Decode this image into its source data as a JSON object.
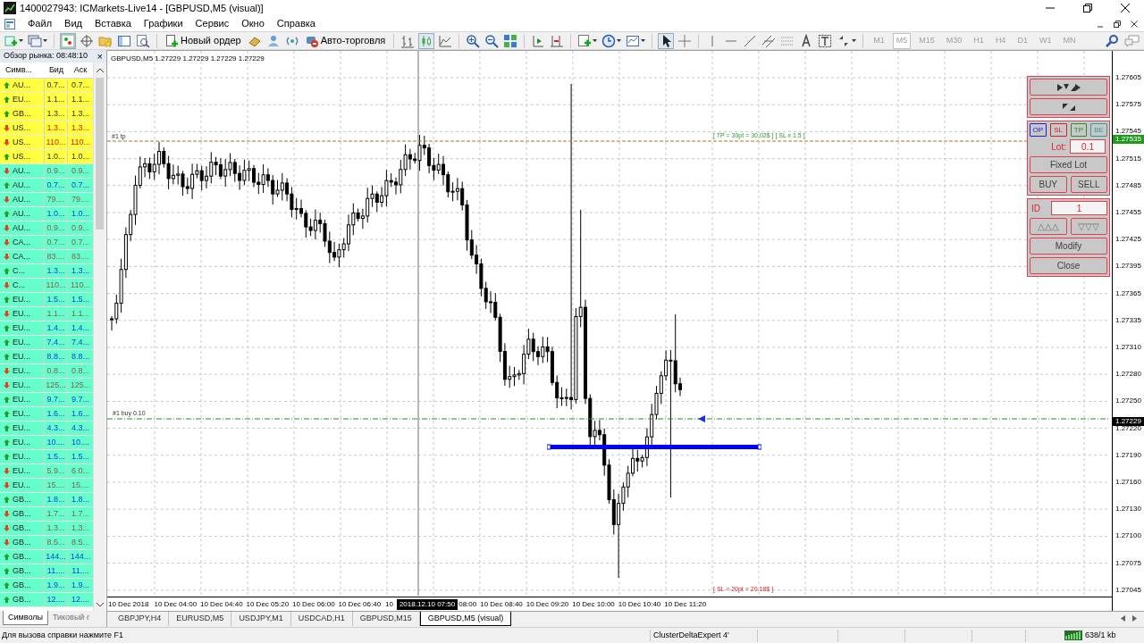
{
  "window": {
    "title": "1400027943: ICMarkets-Live14 - [GBPUSD,M5 (visual)]"
  },
  "menu": [
    "Файл",
    "Вид",
    "Вставка",
    "Графики",
    "Сервис",
    "Окно",
    "Справка"
  ],
  "toolbar": {
    "new_order": "Новый ордер",
    "auto_trading": "Авто-торговля",
    "timeframes": [
      {
        "label": "M1",
        "selected": false
      },
      {
        "label": "M5",
        "selected": true
      },
      {
        "label": "M15",
        "selected": false
      },
      {
        "label": "M30",
        "selected": false
      },
      {
        "label": "H1",
        "selected": false
      },
      {
        "label": "H4",
        "selected": false
      },
      {
        "label": "D1",
        "selected": false
      },
      {
        "label": "W1",
        "selected": false
      },
      {
        "label": "MN",
        "selected": false
      }
    ]
  },
  "market_watch": {
    "title": "Обзор рынка: 08:48:10",
    "close": "×",
    "columns": [
      "Симв...",
      "Бид",
      "Аск"
    ],
    "rows": [
      {
        "symbol": "AU...",
        "bid": "0.7...",
        "ask": "0.7...",
        "rising": true,
        "kind": "highlighted"
      },
      {
        "symbol": "EU...",
        "bid": "1.1...",
        "ask": "1.1...",
        "rising": true,
        "kind": "highlighted"
      },
      {
        "symbol": "GB...",
        "bid": "1.3...",
        "ask": "1.3...",
        "rising": true,
        "kind": "highlighted"
      },
      {
        "symbol": "US...",
        "bid": "1.3...",
        "ask": "1.3...",
        "rising": false,
        "kind": "highlighted"
      },
      {
        "symbol": "US...",
        "bid": "110...",
        "ask": "110...",
        "rising": false,
        "kind": "highlighted"
      },
      {
        "symbol": "US...",
        "bid": "1.0...",
        "ask": "1.0...",
        "rising": true,
        "kind": "highlighted"
      },
      {
        "symbol": "AU...",
        "bid": "0.9...",
        "ask": "0.9...",
        "rising": false,
        "kind": "normal"
      },
      {
        "symbol": "AU...",
        "bid": "0.7...",
        "ask": "0.7...",
        "rising": true,
        "kind": "normal"
      },
      {
        "symbol": "AU...",
        "bid": "79....",
        "ask": "79....",
        "rising": false,
        "kind": "normal"
      },
      {
        "symbol": "AU...",
        "bid": "1.0...",
        "ask": "1.0...",
        "rising": true,
        "kind": "normal"
      },
      {
        "symbol": "AU...",
        "bid": "0.9...",
        "ask": "0.9...",
        "rising": false,
        "kind": "normal"
      },
      {
        "symbol": "CA...",
        "bid": "0.7...",
        "ask": "0.7...",
        "rising": false,
        "kind": "normal"
      },
      {
        "symbol": "CA...",
        "bid": "83....",
        "ask": "83....",
        "rising": false,
        "kind": "normal"
      },
      {
        "symbol": "C...",
        "bid": "1.3...",
        "ask": "1.3...",
        "rising": true,
        "kind": "normal"
      },
      {
        "symbol": "C...",
        "bid": "110...",
        "ask": "110...",
        "rising": false,
        "kind": "normal"
      },
      {
        "symbol": "EU...",
        "bid": "1.5...",
        "ask": "1.5...",
        "rising": true,
        "kind": "normal"
      },
      {
        "symbol": "EU...",
        "bid": "1.1...",
        "ask": "1.1...",
        "rising": false,
        "kind": "normal"
      },
      {
        "symbol": "EU...",
        "bid": "1.4...",
        "ask": "1.4...",
        "rising": true,
        "kind": "normal"
      },
      {
        "symbol": "EU...",
        "bid": "7.4...",
        "ask": "7.4...",
        "rising": true,
        "kind": "normal"
      },
      {
        "symbol": "EU...",
        "bid": "8.8...",
        "ask": "8.8...",
        "rising": true,
        "kind": "normal"
      },
      {
        "symbol": "EU...",
        "bid": "0.8...",
        "ask": "0.8...",
        "rising": false,
        "kind": "normal"
      },
      {
        "symbol": "EU...",
        "bid": "125...",
        "ask": "125...",
        "rising": false,
        "kind": "normal"
      },
      {
        "symbol": "EU...",
        "bid": "9.7...",
        "ask": "9.7...",
        "rising": true,
        "kind": "normal"
      },
      {
        "symbol": "EU...",
        "bid": "1.6...",
        "ask": "1.6...",
        "rising": true,
        "kind": "normal"
      },
      {
        "symbol": "EU...",
        "bid": "4.3...",
        "ask": "4.3...",
        "rising": true,
        "kind": "normal"
      },
      {
        "symbol": "EU...",
        "bid": "10....",
        "ask": "10....",
        "rising": true,
        "kind": "normal"
      },
      {
        "symbol": "EU...",
        "bid": "1.5...",
        "ask": "1.5...",
        "rising": true,
        "kind": "normal"
      },
      {
        "symbol": "EU...",
        "bid": "5.9...",
        "ask": "6.0...",
        "rising": false,
        "kind": "normal"
      },
      {
        "symbol": "EU...",
        "bid": "15....",
        "ask": "15....",
        "rising": false,
        "kind": "normal"
      },
      {
        "symbol": "GB...",
        "bid": "1.8...",
        "ask": "1.8...",
        "rising": true,
        "kind": "normal"
      },
      {
        "symbol": "GB...",
        "bid": "1.7...",
        "ask": "1.7...",
        "rising": false,
        "kind": "normal"
      },
      {
        "symbol": "GB...",
        "bid": "1.3...",
        "ask": "1.3...",
        "rising": false,
        "kind": "normal"
      },
      {
        "symbol": "GB...",
        "bid": "8.5...",
        "ask": "8.5...",
        "rising": false,
        "kind": "normal"
      },
      {
        "symbol": "GB...",
        "bid": "144...",
        "ask": "144...",
        "rising": true,
        "kind": "normal"
      },
      {
        "symbol": "GB...",
        "bid": "11....",
        "ask": "11....",
        "rising": true,
        "kind": "normal"
      },
      {
        "symbol": "GB...",
        "bid": "1.9...",
        "ask": "1.9...",
        "rising": true,
        "kind": "normal"
      },
      {
        "symbol": "GB...",
        "bid": "12....",
        "ask": "12....",
        "rising": true,
        "kind": "normal"
      }
    ],
    "tabs": [
      {
        "label": "Символы",
        "selected": true
      },
      {
        "label": "Тиковый г",
        "selected": false
      }
    ]
  },
  "chart": {
    "header": "GBPUSD,M5  1.27229 1.27229 1.27229 1.27229",
    "labels": [
      {
        "text": "#1 tp",
        "kind": "order"
      },
      {
        "text": "[ TP = 30pt = 30.02$ ] [ SL x 1.5 ]",
        "kind": "tp"
      },
      {
        "text": "#1 buy 0.10",
        "kind": "order"
      },
      {
        "text": "[ SL = 20pt = 20.18$ ]",
        "kind": "sl"
      }
    ],
    "price_axis": [
      "1.27605",
      "1.27575",
      "1.27545",
      "1.27515",
      "1.27485",
      "1.27455",
      "1.27425",
      "1.27395",
      "1.27365",
      "1.27335",
      "1.27310",
      "1.27280",
      "1.27250",
      "1.27220",
      "1.27190",
      "1.27160",
      "1.27130",
      "1.27100",
      "1.27075",
      "1.27045"
    ],
    "price_markers": [
      {
        "text": "1.27535",
        "kind": "tp"
      },
      {
        "text": "1.27229",
        "kind": "bid"
      }
    ],
    "time_axis": [
      {
        "text": "10 Dec 2018",
        "kind": "label"
      },
      {
        "text": "10 Dec 04:00",
        "kind": "label"
      },
      {
        "text": "10 Dec 04:40",
        "kind": "label"
      },
      {
        "text": "10 Dec 05:20",
        "kind": "label"
      },
      {
        "text": "10 Dec 06:00",
        "kind": "label"
      },
      {
        "text": "10 Dec 06:40",
        "kind": "label"
      },
      {
        "text": "10",
        "kind": "partial"
      },
      {
        "text": "2018.12.10 07:50",
        "kind": "cursor"
      },
      {
        "text": "08:00",
        "kind": "partial"
      },
      {
        "text": "10 Dec 08:40",
        "kind": "label"
      },
      {
        "text": "10 Dec 09:20",
        "kind": "label"
      },
      {
        "text": "10 Dec 10:00",
        "kind": "label"
      },
      {
        "text": "10 Dec 10:40",
        "kind": "label"
      },
      {
        "text": "10 Dec 11:20",
        "kind": "label"
      }
    ]
  },
  "trade_panel": {
    "mode_buttons": [
      {
        "label": "OP",
        "color": "#2020d0"
      },
      {
        "label": "SL",
        "color": "#d02020"
      },
      {
        "label": "TP",
        "color": "#2a8a2a"
      },
      {
        "label": "BE",
        "color": "#2a9a9a"
      }
    ],
    "lot_label": "Lot:",
    "lot": "0.1",
    "fixed_lot": "Fixed Lot",
    "buy": "BUY",
    "sell": "SELL",
    "id_label": "ID",
    "id": "1",
    "up": "△△△",
    "down": "▽▽▽",
    "modify": "Modify",
    "close": "Close"
  },
  "chart_tabs": [
    {
      "label": "GBPJPY,H4",
      "selected": false
    },
    {
      "label": "EURUSD,M5",
      "selected": false
    },
    {
      "label": "USDJPY,M1",
      "selected": false
    },
    {
      "label": "USDCAD,H1",
      "selected": false
    },
    {
      "label": "GBPUSD,M15",
      "selected": false
    },
    {
      "label": "GBPUSD,M5 (visual)",
      "selected": true
    }
  ],
  "status_bar": {
    "help": "Для вызова справки нажмите F1",
    "expert": "ClusterDeltaExpert 4'",
    "traffic": "638/1 kb"
  }
}
